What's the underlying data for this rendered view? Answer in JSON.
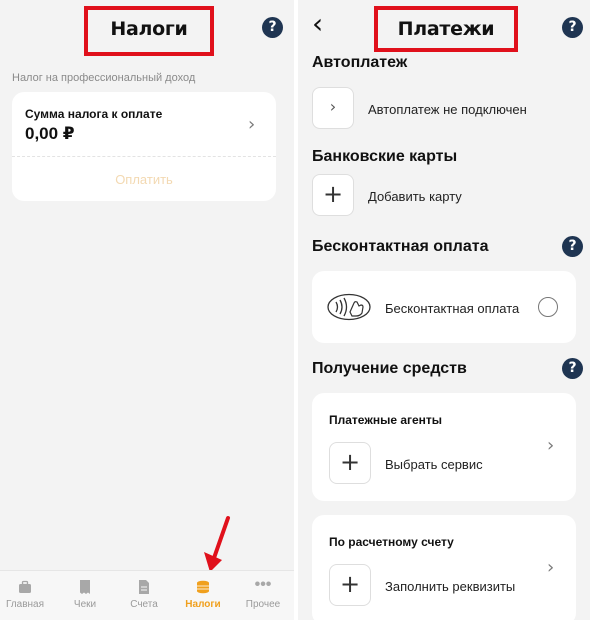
{
  "left": {
    "title": "Налоги",
    "help": "?",
    "section_label": "Налог на профессиональный доход",
    "tax_card": {
      "label": "Сумма налога к оплате",
      "amount": "0,00 ₽",
      "pay_button": "Оплатить"
    },
    "tabbar": {
      "items": [
        {
          "label": "Главная",
          "icon": "briefcase-icon"
        },
        {
          "label": "Чеки",
          "icon": "receipt-icon"
        },
        {
          "label": "Счета",
          "icon": "document-icon"
        },
        {
          "label": "Налоги",
          "icon": "coins-icon",
          "active": true
        },
        {
          "label": "Прочее",
          "icon": "more-icon"
        }
      ]
    }
  },
  "right": {
    "back": "‹",
    "title": "Платежи",
    "help": "?",
    "autopay": {
      "heading": "Автоплатеж",
      "status": "Автоплатеж не подключен"
    },
    "cards": {
      "heading": "Банковские карты",
      "add": "Добавить карту"
    },
    "contactless": {
      "heading": "Бесконтактная оплата",
      "label": "Бесконтактная оплата"
    },
    "receive": {
      "heading": "Получение средств",
      "agents": {
        "title": "Платежные агенты",
        "action": "Выбрать сервис"
      },
      "account": {
        "title": "По расчетному счету",
        "action": "Заполнить реквизиты"
      }
    }
  },
  "colors": {
    "highlight": "#e0101b",
    "accent": "#f0a01e",
    "help_icon": "#1f3552"
  }
}
